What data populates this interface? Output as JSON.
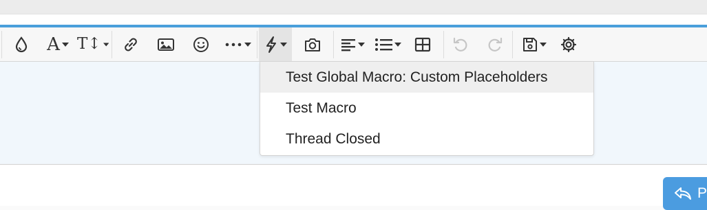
{
  "toolbar": {
    "accent_color": "#4a9fdb",
    "text_style_glyph": "A",
    "font_size_glyph": "T↕",
    "buttons": [
      {
        "name": "text-color-button",
        "icon": "droplet-icon"
      },
      {
        "name": "text-style-button",
        "icon": "font-icon"
      },
      {
        "name": "font-size-button",
        "icon": "text-height-icon"
      },
      {
        "name": "link-button",
        "icon": "link-icon"
      },
      {
        "name": "image-button",
        "icon": "image-icon"
      },
      {
        "name": "emoji-button",
        "icon": "smile-icon"
      },
      {
        "name": "more-button",
        "icon": "ellipsis-icon"
      },
      {
        "name": "macro-button",
        "icon": "bolt-icon"
      },
      {
        "name": "screenshot-button",
        "icon": "camera-icon"
      },
      {
        "name": "align-button",
        "icon": "align-left-icon"
      },
      {
        "name": "list-button",
        "icon": "list-icon"
      },
      {
        "name": "table-button",
        "icon": "table-icon"
      },
      {
        "name": "undo-button",
        "icon": "undo-icon"
      },
      {
        "name": "redo-button",
        "icon": "redo-icon"
      },
      {
        "name": "drafts-button",
        "icon": "floppy-icon"
      },
      {
        "name": "settings-button",
        "icon": "gear-icon"
      }
    ]
  },
  "macro_menu": {
    "items": [
      {
        "label": "Test Global Macro: Custom Placeholders"
      },
      {
        "label": "Test Macro"
      },
      {
        "label": "Thread Closed"
      }
    ]
  },
  "reply_button": {
    "label": "P",
    "color": "#4b9ce0"
  }
}
